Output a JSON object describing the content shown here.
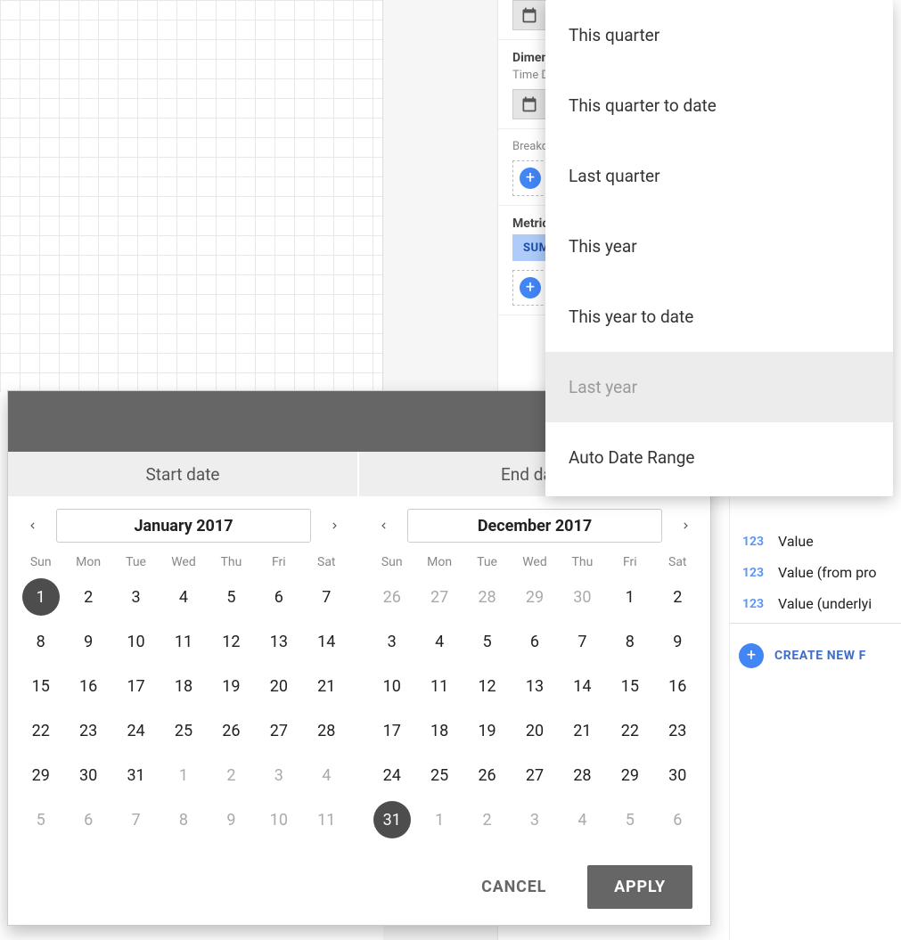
{
  "config": {
    "dimension_title": "Dimension",
    "time_dimension_label": "Time Dimension",
    "breakdown_label": "Breakdown Dimension",
    "metric_title": "Metric",
    "sum_chip": "SUM"
  },
  "fields": {
    "items": [
      "Value",
      "Value (from pro",
      "Value (underlyi"
    ],
    "create_label": "CREATE NEW F"
  },
  "preset_menu": {
    "items": [
      "This quarter",
      "This quarter to date",
      "Last quarter",
      "This year",
      "This year to date",
      "Last year",
      "Auto Date Range"
    ],
    "highlighted_index": 5
  },
  "date_picker": {
    "start_label": "Start date",
    "end_label": "End date",
    "cancel_label": "CANCEL",
    "apply_label": "APPLY",
    "dow": [
      "Sun",
      "Mon",
      "Tue",
      "Wed",
      "Thu",
      "Fri",
      "Sat"
    ],
    "start": {
      "month_label": "January 2017",
      "weeks": [
        [
          {
            "d": 1,
            "o": false,
            "sel": true
          },
          {
            "d": 2,
            "o": false
          },
          {
            "d": 3,
            "o": false
          },
          {
            "d": 4,
            "o": false
          },
          {
            "d": 5,
            "o": false
          },
          {
            "d": 6,
            "o": false
          },
          {
            "d": 7,
            "o": false
          }
        ],
        [
          {
            "d": 8,
            "o": false
          },
          {
            "d": 9,
            "o": false
          },
          {
            "d": 10,
            "o": false
          },
          {
            "d": 11,
            "o": false
          },
          {
            "d": 12,
            "o": false
          },
          {
            "d": 13,
            "o": false
          },
          {
            "d": 14,
            "o": false
          }
        ],
        [
          {
            "d": 15,
            "o": false
          },
          {
            "d": 16,
            "o": false
          },
          {
            "d": 17,
            "o": false
          },
          {
            "d": 18,
            "o": false
          },
          {
            "d": 19,
            "o": false
          },
          {
            "d": 20,
            "o": false
          },
          {
            "d": 21,
            "o": false
          }
        ],
        [
          {
            "d": 22,
            "o": false
          },
          {
            "d": 23,
            "o": false
          },
          {
            "d": 24,
            "o": false
          },
          {
            "d": 25,
            "o": false
          },
          {
            "d": 26,
            "o": false
          },
          {
            "d": 27,
            "o": false
          },
          {
            "d": 28,
            "o": false
          }
        ],
        [
          {
            "d": 29,
            "o": false
          },
          {
            "d": 30,
            "o": false
          },
          {
            "d": 31,
            "o": false
          },
          {
            "d": 1,
            "o": true
          },
          {
            "d": 2,
            "o": true
          },
          {
            "d": 3,
            "o": true
          },
          {
            "d": 4,
            "o": true
          }
        ],
        [
          {
            "d": 5,
            "o": true
          },
          {
            "d": 6,
            "o": true
          },
          {
            "d": 7,
            "o": true
          },
          {
            "d": 8,
            "o": true
          },
          {
            "d": 9,
            "o": true
          },
          {
            "d": 10,
            "o": true
          },
          {
            "d": 11,
            "o": true
          }
        ]
      ]
    },
    "end": {
      "month_label": "December 2017",
      "weeks": [
        [
          {
            "d": 26,
            "o": true
          },
          {
            "d": 27,
            "o": true
          },
          {
            "d": 28,
            "o": true
          },
          {
            "d": 29,
            "o": true
          },
          {
            "d": 30,
            "o": true
          },
          {
            "d": 1,
            "o": false
          },
          {
            "d": 2,
            "o": false
          }
        ],
        [
          {
            "d": 3,
            "o": false
          },
          {
            "d": 4,
            "o": false
          },
          {
            "d": 5,
            "o": false
          },
          {
            "d": 6,
            "o": false
          },
          {
            "d": 7,
            "o": false
          },
          {
            "d": 8,
            "o": false
          },
          {
            "d": 9,
            "o": false
          }
        ],
        [
          {
            "d": 10,
            "o": false
          },
          {
            "d": 11,
            "o": false
          },
          {
            "d": 12,
            "o": false
          },
          {
            "d": 13,
            "o": false
          },
          {
            "d": 14,
            "o": false
          },
          {
            "d": 15,
            "o": false
          },
          {
            "d": 16,
            "o": false
          }
        ],
        [
          {
            "d": 17,
            "o": false
          },
          {
            "d": 18,
            "o": false
          },
          {
            "d": 19,
            "o": false
          },
          {
            "d": 20,
            "o": false
          },
          {
            "d": 21,
            "o": false
          },
          {
            "d": 22,
            "o": false
          },
          {
            "d": 23,
            "o": false
          }
        ],
        [
          {
            "d": 24,
            "o": false
          },
          {
            "d": 25,
            "o": false
          },
          {
            "d": 26,
            "o": false
          },
          {
            "d": 27,
            "o": false
          },
          {
            "d": 28,
            "o": false
          },
          {
            "d": 29,
            "o": false
          },
          {
            "d": 30,
            "o": false
          }
        ],
        [
          {
            "d": 31,
            "o": false,
            "sel": true
          },
          {
            "d": 1,
            "o": true
          },
          {
            "d": 2,
            "o": true
          },
          {
            "d": 3,
            "o": true
          },
          {
            "d": 4,
            "o": true
          },
          {
            "d": 5,
            "o": true
          },
          {
            "d": 6,
            "o": true
          }
        ]
      ]
    }
  }
}
